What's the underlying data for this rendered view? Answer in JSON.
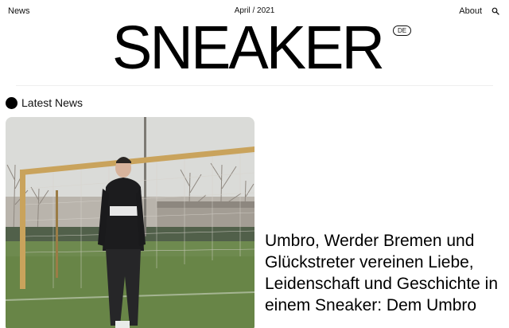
{
  "nav": {
    "news_label": "News",
    "date_label": "April / 2021",
    "about_label": "About",
    "search_icon": "search-icon"
  },
  "logo": {
    "text": "SNEAKER",
    "language_badge": "DE"
  },
  "section": {
    "title": "Latest News",
    "bullet_color": "#000000"
  },
  "article": {
    "title": "Umbro, Werder Bremen und Glückstreter vereinen Liebe, Leidenschaft und Geschichte in einem Sneaker: Dem Umbro",
    "image_icon": "photo-icon"
  }
}
